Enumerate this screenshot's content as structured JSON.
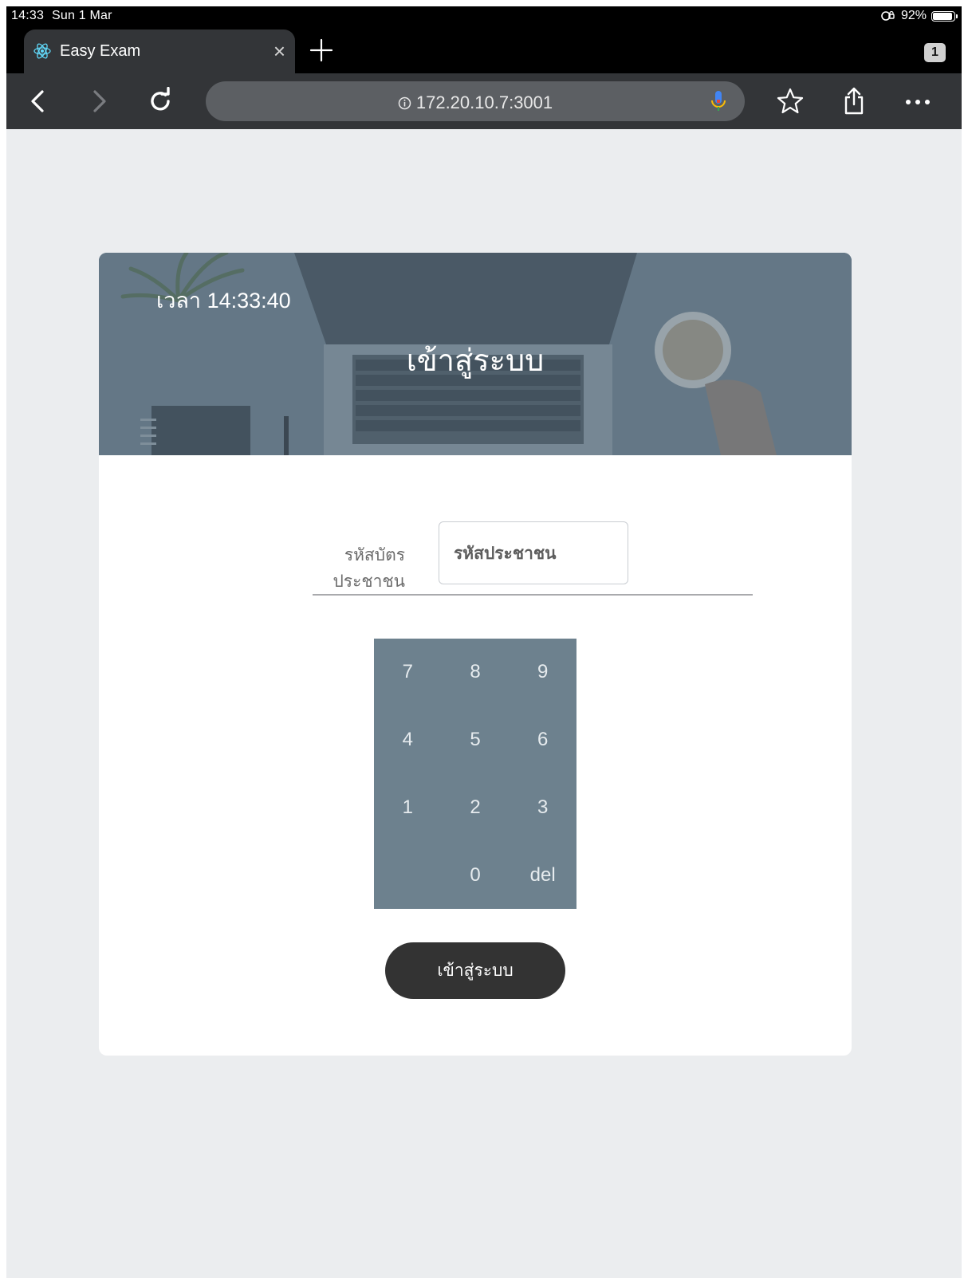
{
  "status_bar": {
    "time": "14:33",
    "date": "Sun 1 Mar",
    "battery_percent": "92%",
    "battery_level": 0.92
  },
  "browser": {
    "tab_title": "Easy Exam",
    "tab_close": "×",
    "tab_count": "1",
    "address": "172.20.10.7:3001",
    "colors": {
      "mic": "#4285f4",
      "tab_icon": "#61dafb"
    }
  },
  "login": {
    "clock": "เวลา 14:33:40",
    "title": "เข้าสู่ระบบ",
    "id_label": "รหัสบัตรประชาชน",
    "id_value": "",
    "id_placeholder": "รหัสประชาชน",
    "keypad": [
      "7",
      "8",
      "9",
      "4",
      "5",
      "6",
      "1",
      "2",
      "3",
      "",
      "0",
      "del"
    ],
    "submit_label": "เข้าสู่ระบบ",
    "colors": {
      "keypad_bg": "#6d818e",
      "button_bg": "#333333",
      "hero_overlay": "#5d7180"
    }
  }
}
